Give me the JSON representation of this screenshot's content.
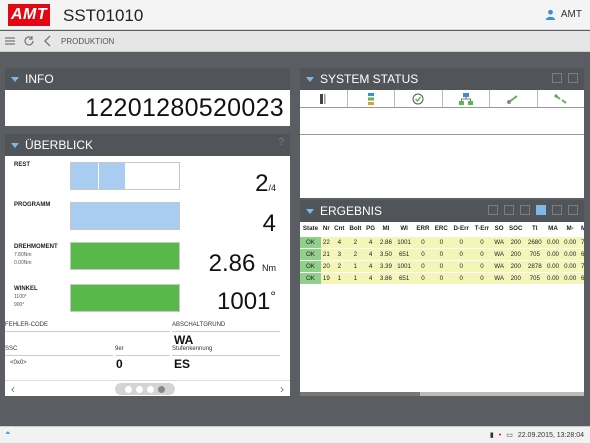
{
  "header": {
    "logo": "AMT",
    "title": "SST01010",
    "user": "AMT"
  },
  "nav": {
    "breadcrumb": "PRODUKTION"
  },
  "info": {
    "title": "INFO",
    "value": "12201280520023"
  },
  "overview": {
    "title": "ÜBERBLICK",
    "help": "?",
    "rows": [
      {
        "label": "REST",
        "sub1": "",
        "sub2": "",
        "value": "2",
        "unit": "/4",
        "fill_fraction": 0.5,
        "color": "#a9cdf0"
      },
      {
        "label": "PROGRAMM",
        "sub1": "",
        "sub2": "",
        "value": "4",
        "unit": "",
        "fill_fraction": 1.0,
        "color": "#a9cdf0"
      },
      {
        "label": "DREHMOMENT",
        "sub1": "7.80Nm",
        "sub2": "0.00Nm",
        "value": "2.86",
        "unit": "Nm",
        "fill_fraction": 1.0,
        "color": "#58b84a"
      },
      {
        "label": "WINKEL",
        "sub1": "1100°",
        "sub2": "900°",
        "value": "1001",
        "unit": "°",
        "fill_fraction": 1.0,
        "color": "#58b84a"
      }
    ],
    "fehler_code_label": "FEHLER-CODE",
    "abschaltgrund_label": "ABSCHALTGRUND",
    "abschaltgrund_value": "WA",
    "ssc_label": "SSC",
    "ssc_value": "<0x0>",
    "nr_label": "9er",
    "nr_value": "0",
    "stufen_label": "Stufenkennung",
    "stufen_value": "ES"
  },
  "system_status": {
    "title": "SYSTEM STATUS",
    "icons": [
      "tool-icon",
      "network-icon",
      "check-icon",
      "network-icon",
      "link-icon",
      "link-broken-icon"
    ]
  },
  "ergebnis": {
    "title": "ERGEBNIS",
    "columns": [
      "State",
      "Nr",
      "Cnt",
      "Bolt",
      "PG",
      "MI",
      "WI",
      "ERR",
      "ERC",
      "D-Err",
      "T-Err",
      "SO",
      "SOC",
      "TI",
      "MA",
      "M-",
      "M+"
    ],
    "rows": [
      [
        "OK",
        "22",
        "4",
        "2",
        "4",
        "2.86",
        "1001",
        "0",
        "0",
        "0",
        "0",
        "WA",
        "200",
        "2680",
        "0.00",
        "0.00",
        "7.8"
      ],
      [
        "OK",
        "21",
        "3",
        "2",
        "4",
        "3.50",
        "651",
        "0",
        "0",
        "0",
        "0",
        "WA",
        "200",
        "705",
        "0.00",
        "0.00",
        "6.5"
      ],
      [
        "OK",
        "20",
        "2",
        "1",
        "4",
        "3.39",
        "1001",
        "0",
        "0",
        "0",
        "0",
        "WA",
        "200",
        "2878",
        "0.00",
        "0.00",
        "7.8"
      ],
      [
        "OK",
        "19",
        "1",
        "1",
        "4",
        "3.86",
        "651",
        "0",
        "0",
        "0",
        "0",
        "WA",
        "200",
        "705",
        "0.00",
        "0.00",
        "6.5"
      ]
    ]
  },
  "status_bar": {
    "datetime": "22.09.2015, 13:28:04"
  }
}
